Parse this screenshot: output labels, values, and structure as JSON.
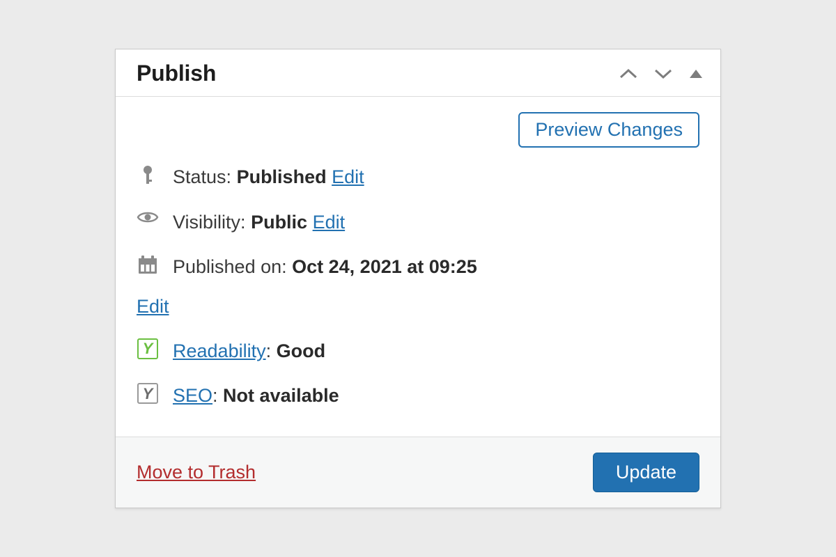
{
  "panel": {
    "title": "Publish",
    "preview_button": "Preview Changes",
    "status": {
      "label": "Status:",
      "value": "Published",
      "edit": "Edit"
    },
    "visibility": {
      "label": "Visibility:",
      "value": "Public",
      "edit": "Edit"
    },
    "published_on": {
      "label": "Published on:",
      "value": "Oct 24, 2021 at 09:25",
      "edit": "Edit"
    },
    "readability": {
      "label": "Readability",
      "value": "Good"
    },
    "seo": {
      "label": "SEO",
      "value": "Not available"
    },
    "trash": "Move to Trash",
    "update": "Update"
  }
}
